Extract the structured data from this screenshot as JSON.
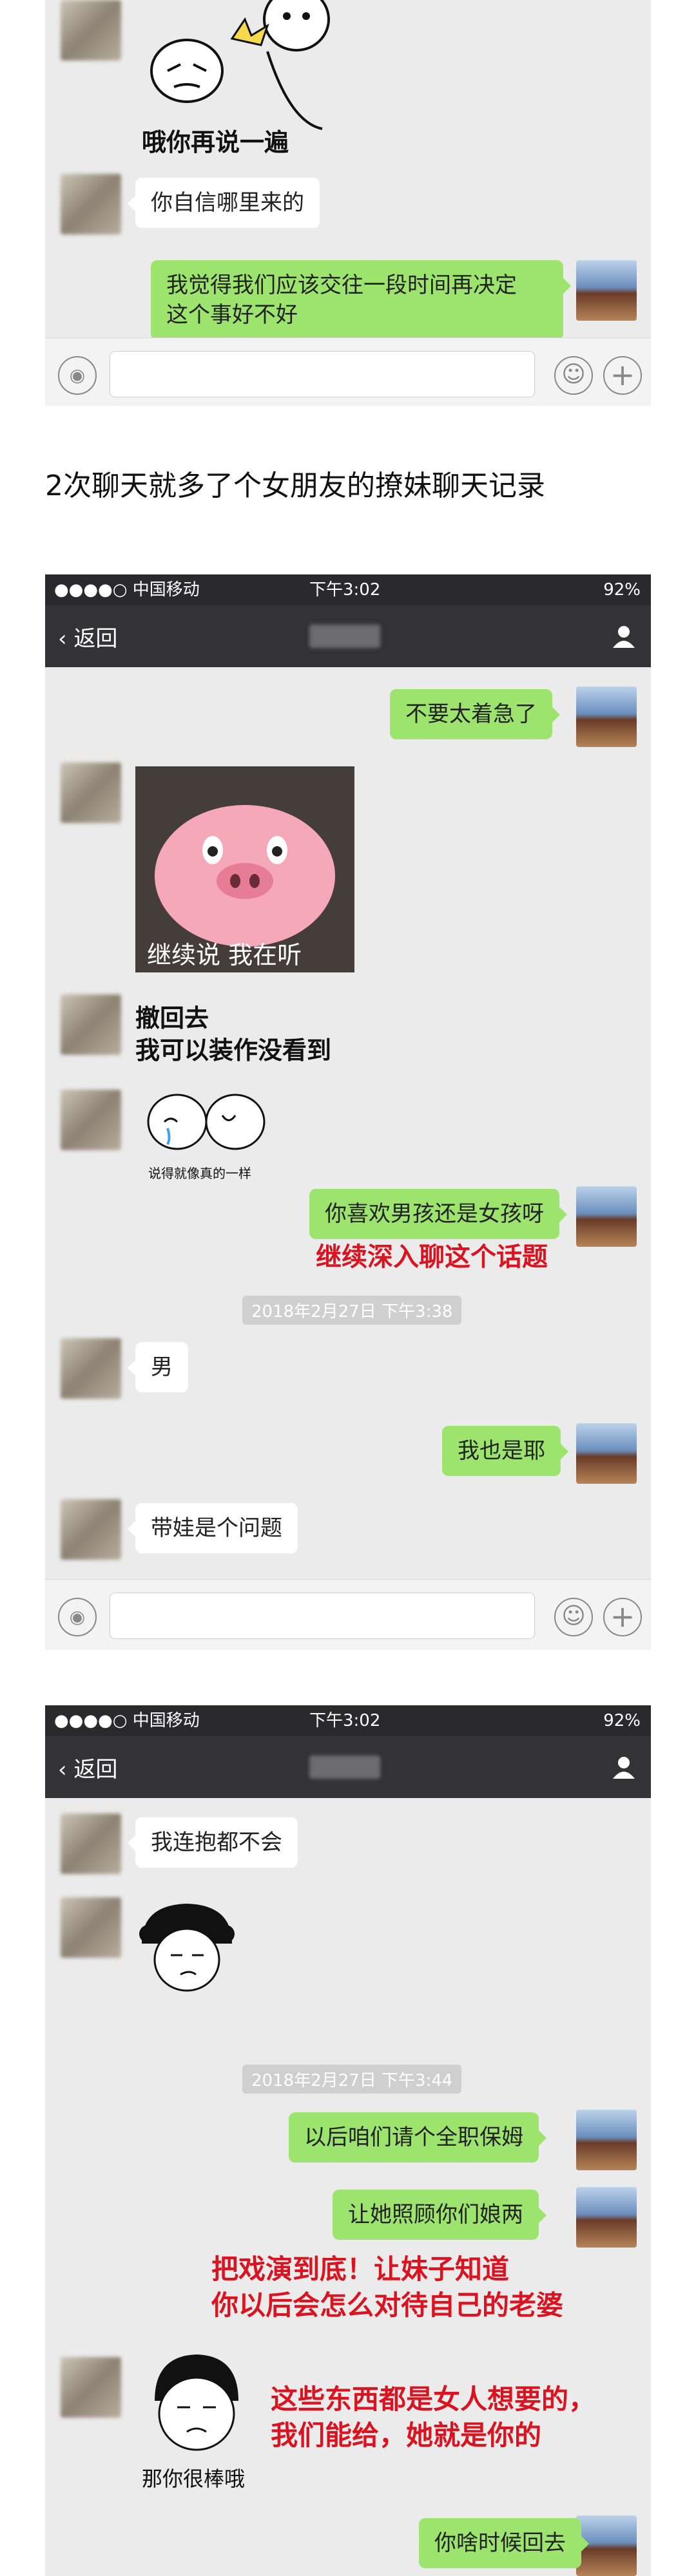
{
  "section_heading": "2次聊天就多了个女朋友的撩妹聊天记录",
  "panel1": {
    "sticker_text": "哦你再说一遍",
    "msg1": "你自信哪里来的",
    "msg2_line1": "我觉得我们应该交往一段时间再决定",
    "msg2_line2": "这个事好不好"
  },
  "panel2": {
    "status": {
      "carrier": "●●●●○ 中国移动",
      "time": "下午3:02",
      "battery": "92%"
    },
    "back": "返回",
    "msg1": "不要太着急了",
    "pig_caption": "继续说 我在听",
    "msg2_line1": "撤回去",
    "msg2_line2": "我可以装作没看到",
    "sticker2_caption": "说得就像真的一样",
    "msg3": "你喜欢男孩还是女孩呀",
    "note": "继续深入聊这个话题",
    "stamp": "2018年2月27日 下午3:38",
    "msg4": "男",
    "msg5": "我也是耶",
    "msg6": "带娃是个问题"
  },
  "panel3": {
    "status": {
      "carrier": "●●●●○ 中国移动",
      "time": "下午3:02",
      "battery": "92%"
    },
    "back": "返回",
    "msg1": "我连抱都不会",
    "stamp": "2018年2月27日 下午3:44",
    "msg2": "以后咱们请个全职保姆",
    "msg3": "让她照顾你们娘两",
    "note1_line1": "把戏演到底！让妹子知道",
    "note1_line2": "你以后会怎么对待自己的老婆",
    "note2_line1": "这些东西都是女人想要的，",
    "note2_line2": "我们能给，她就是你的",
    "sticker_caption": "那你很棒哦",
    "msg4": "你啥时候回去"
  },
  "colors": {
    "green_bubble": "#9de46f",
    "red_note": "#d91420",
    "chat_bg": "#ebebeb"
  }
}
